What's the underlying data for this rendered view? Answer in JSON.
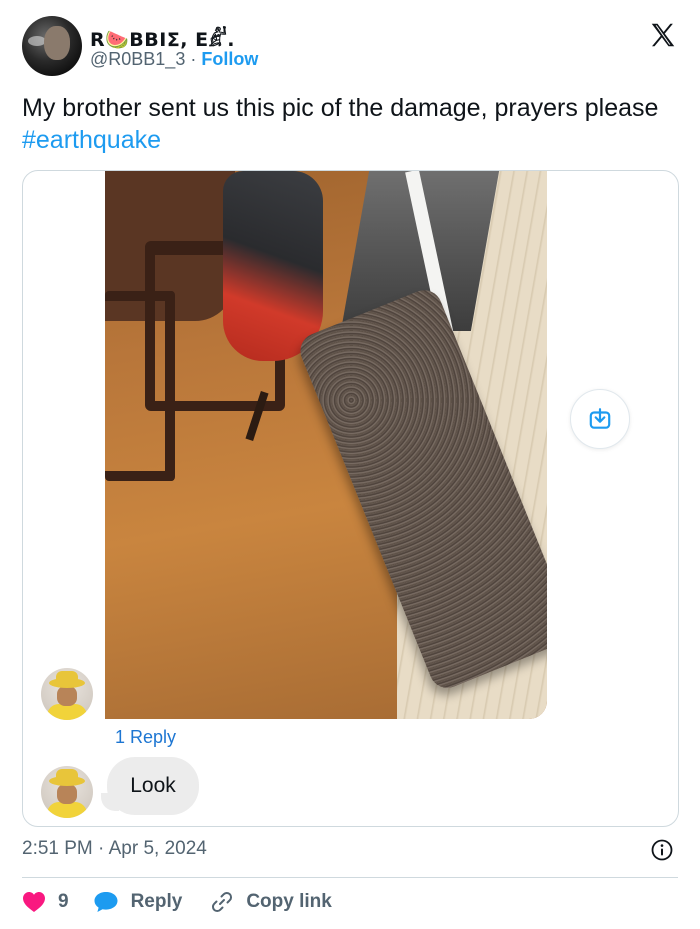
{
  "author": {
    "display_name": "R🍉BBIΣ, E𓀊.",
    "handle": "@R0BB1_3",
    "separator": "·",
    "follow_label": "Follow"
  },
  "tweet": {
    "text_main": "My brother sent us this pic of the damage, prayers please ",
    "hashtag": "#earthquake"
  },
  "conversation": {
    "reply_count_label": "1 Reply",
    "reply_message": "Look"
  },
  "meta": {
    "time": "2:51 PM",
    "separator": "·",
    "date": "Apr 5, 2024"
  },
  "actions": {
    "likes_count": "9",
    "reply_label": "Reply",
    "copy_link_label": "Copy link"
  },
  "colors": {
    "accent": "#1d9bf0",
    "heart": "#f91880",
    "text_secondary": "#536471"
  },
  "icons": {
    "brand": "x-logo-icon",
    "save": "download-icon",
    "info": "info-icon",
    "like": "heart-icon",
    "reply": "speech-bubble-icon",
    "copy": "link-icon"
  }
}
